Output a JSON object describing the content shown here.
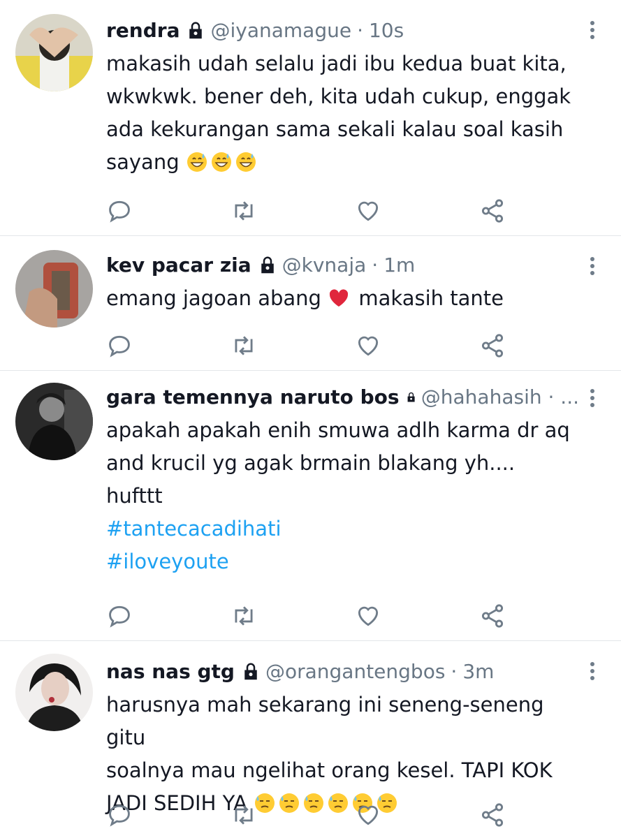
{
  "tweets": [
    {
      "name": "rendra",
      "handle": "@iyanamague",
      "separator": "·",
      "time": "10s",
      "lines": [
        "makasih udah selalu jadi ibu kedua buat kita,",
        "wkwkwk. bener deh, kita udah cukup, enggak",
        "ada kekurangan sama sekali kalau soal kasih"
      ],
      "last_line": "sayang",
      "emoji": [
        "grinning-sweat-emoji",
        "grinning-sweat-emoji",
        "grinning-sweat-emoji"
      ]
    },
    {
      "name": "kev pacar zia",
      "handle": "@kvnaja",
      "separator": "·",
      "time": "1m",
      "text_before": "emang jagoan abang",
      "emoji": "red-heart-emoji",
      "text_after": "makasih tante"
    },
    {
      "name": "gara temennya naruto bos",
      "handle": "@hahahasih · ...",
      "lines": [
        "apakah apakah enih smuwa adlh karma dr aq",
        "and krucil yg agak brmain blakang yh....",
        "hufttt"
      ],
      "hashtags": [
        "#tantecacadihati",
        "#iloveyoute"
      ]
    },
    {
      "name": "nas nas gtg",
      "handle": "@orangantengbos",
      "separator": "·",
      "time": "3m",
      "lines": [
        "harusnya mah sekarang ini seneng-seneng gitu",
        "soalnya mau ngelihat orang kesel. TAPI KOK"
      ],
      "last_line": "JADI SEDIH YA",
      "emoji": [
        "downcast-sweat-emoji",
        "downcast-sweat-emoji",
        "downcast-sweat-emoji",
        "downcast-sweat-emoji",
        "downcast-sweat-emoji",
        "downcast-sweat-emoji"
      ]
    }
  ],
  "icons": {
    "reply": "reply-icon",
    "retweet": "retweet-icon",
    "like": "heart-icon",
    "share": "share-icon",
    "protected": "lock-icon",
    "more": "more-vertical-icon"
  },
  "colors": {
    "name": "#141823",
    "meta": "#687684",
    "hashtag": "#1da1f2",
    "action_icon": "#6f7c89",
    "divider": "#e3e6e9"
  }
}
